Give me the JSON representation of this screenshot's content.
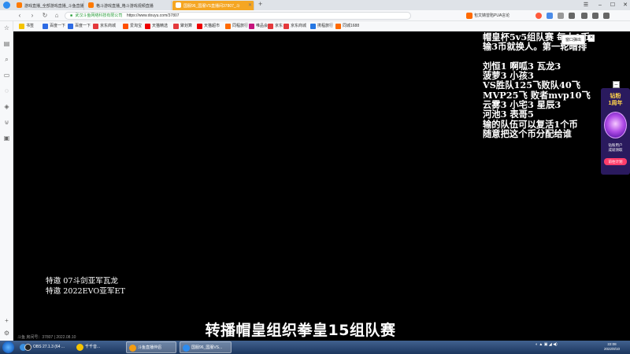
{
  "browser": {
    "tabs": [
      {
        "label": "游戏直播_全部游戏直播_斗鱼直播",
        "active": false
      },
      {
        "label": "格斗游戏直播_格斗游戏视频直播",
        "active": false
      },
      {
        "label": "国服96_国服VS直播间37807_斗",
        "active": true
      }
    ],
    "window_controls": [
      "☰",
      "–",
      "☐",
      "✕"
    ],
    "address": {
      "company": "武汉斗鱼网络科技有限公司",
      "url": "https://www.douyu.com/37807",
      "right_text": "包文婧曾陷PUA言论"
    },
    "bookmarks": [
      "书签",
      "百度一下",
      "百度一下",
      "京东商城",
      "爱淘宝",
      "天猫精选",
      "聚划算",
      "天猫超市",
      "同程旅行",
      "唯品会",
      "京东",
      "京东商城",
      "携程旅行",
      "同城1688"
    ]
  },
  "video": {
    "right_overlay_lines": [
      "帽皇杯5v5组队赛 每人1币",
      "输3币就换人。第一轮暗排",
      "",
      "刘恒1 啊呱3 瓦龙3",
      "菠萝3 小孩3",
      "VS胜队125飞败队40飞",
      "MVP25飞 败者mvp10飞",
      "云雾3 小宅3 星辰3",
      "河池3 表哥5",
      "输的队伍可以复活1个币",
      "随意把这个币分配给谁"
    ],
    "popout_label": "窗口弹出",
    "popout_close": "✕",
    "left_overlay_lines": [
      "特邀 07斗剑亚军瓦龙",
      "特邀 2022EVO亚军ET"
    ],
    "caption": "转播帽皇组织拳皇15组队赛",
    "status_line": "斗鱼 房间号：37807 | 2022.08.10"
  },
  "ad": {
    "close": "–",
    "title": "钻粉\n1周年",
    "subtitle": "钻粉用户\n成就领取",
    "button": "前往计划"
  },
  "taskbar": {
    "items": [
      {
        "label": "",
        "icon_color": "#3a8fe0",
        "pinned": true
      },
      {
        "label": "OBS 27.1.3 (64 ...",
        "icon_color": "#222222",
        "active": false
      },
      {
        "label": "千千音...",
        "icon_color": "#f5c400",
        "active": false
      },
      {
        "label": "斗鱼直播伴侣",
        "icon_color": "#f39c12",
        "active": true
      },
      {
        "label": "国服96_国服VS...",
        "icon_color": "#2d8cf0",
        "active": false
      }
    ],
    "clock_time": "22:08",
    "clock_date": "2022/8/10"
  },
  "colors": {
    "active_tab": "#f5a623",
    "url_green": "#2a9d3c",
    "taskbar": "#1c365e"
  }
}
